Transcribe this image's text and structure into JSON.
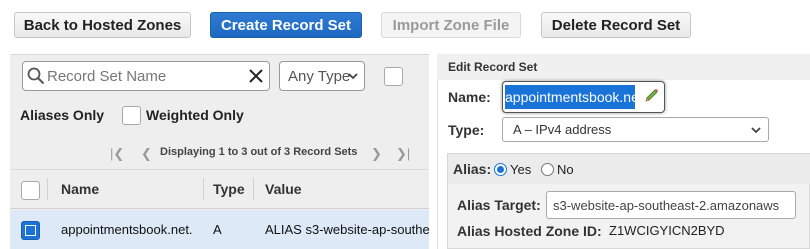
{
  "toolbar": {
    "back_label": "Back to Hosted Zones",
    "create_label": "Create Record Set",
    "import_label": "Import Zone File",
    "delete_label": "Delete Record Set"
  },
  "filters": {
    "search_placeholder": "Record Set Name",
    "type_select": "Any Type",
    "aliases_only": "Aliases Only",
    "weighted_only": "Weighted Only"
  },
  "pager": {
    "text": "Displaying 1 to 3 out of 3 Record Sets"
  },
  "table": {
    "columns": [
      "Name",
      "Type",
      "Value"
    ],
    "rows": [
      {
        "name": "appointmentsbook.net.",
        "type": "A",
        "value": "ALIAS s3-website-ap-southe"
      }
    ]
  },
  "edit_panel": {
    "title": "Edit Record Set",
    "name_label": "Name:",
    "name_value": "appointmentsbook.net",
    "type_label": "Type:",
    "type_value": "A – IPv4 address",
    "alias_label": "Alias:",
    "alias_yes": "Yes",
    "alias_no": "No",
    "alias_target_label": "Alias Target:",
    "alias_target_value": "s3-website-ap-southeast-2.amazonaws",
    "alias_zone_label": "Alias Hosted Zone ID:",
    "alias_zone_value": "Z1WCIGYICN2BYD"
  },
  "colors": {
    "primary": "#1d68c0",
    "selection": "#1a73d9",
    "selected_row": "#dde9f7"
  }
}
